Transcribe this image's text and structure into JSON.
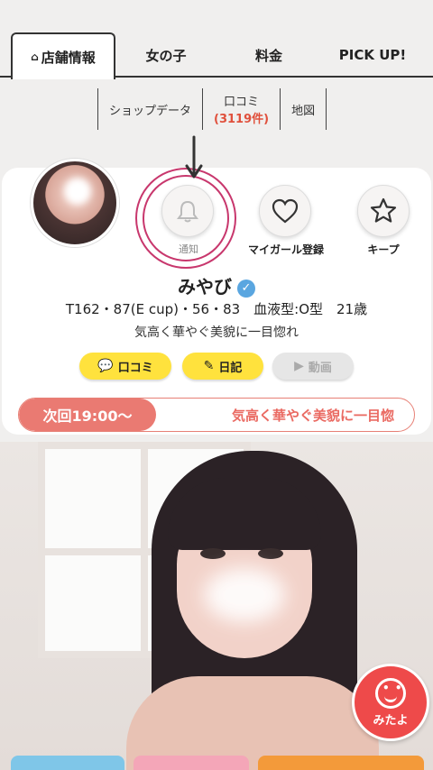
{
  "tabs": [
    {
      "label": "店舗情報",
      "active": true
    },
    {
      "label": "女の子"
    },
    {
      "label": "料金"
    },
    {
      "label": "PICK UP!"
    }
  ],
  "subnav": {
    "shop_data": "ショップデータ",
    "reviews_label": "口コミ",
    "reviews_count": "(3119件)",
    "map": "地図"
  },
  "actions": {
    "notify": "通知",
    "my_girl": "マイガール登録",
    "keep": "キープ"
  },
  "profile": {
    "name": "みやび",
    "stats": "T162・87(E cup)・56・83　血液型:O型　21歳",
    "catchphrase": "気高く華やぐ美貌に一目惚れ"
  },
  "buttons": {
    "review": "口コミ",
    "diary": "日記",
    "video": "動画"
  },
  "next_bar": {
    "time": "次回19:00〜",
    "message": "気高く華やぐ美貌に一目惚"
  },
  "float_button": {
    "label": "みたよ"
  },
  "colors": {
    "accent": "#e0503c",
    "ring": "#c8376d",
    "pill_yellow": "#ffe23d",
    "next_bar": "#ea7a72",
    "mitayo": "#ee4a4a"
  },
  "icons": [
    "home-icon",
    "bell-icon",
    "heart-icon",
    "star-icon",
    "chat-icon",
    "edit-icon",
    "camera-icon",
    "smile-icon",
    "verified-icon",
    "arrow-down-icon"
  ]
}
